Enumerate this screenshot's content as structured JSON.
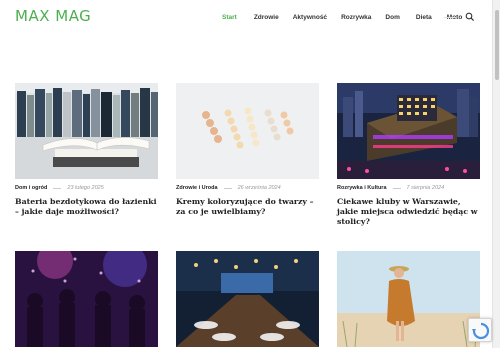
{
  "header": {
    "logo": "MAX MAG",
    "nav": [
      "Start",
      "Zdrowie",
      "Aktywność",
      "Rozrywka",
      "Dom",
      "Dieta",
      "Moto"
    ],
    "active": "Start",
    "icons": {
      "search": "search-icon"
    }
  },
  "posts": [
    {
      "category": "Dom i ogród",
      "date": "23 lutego 2025",
      "title": "Bateria bezdotykowa do łazienki – jakie daje możliwości?",
      "image": "books-illustration"
    },
    {
      "category": "Zdrowie i Uroda",
      "date": "26 września 2024",
      "title": "Kremy koloryzujące do twarzy – za co je uwielbiamy?",
      "image": "cream-swatches-illustration"
    },
    {
      "category": "Rozrywka i Kultura",
      "date": "7 sierpnia 2024",
      "title": "Ciekawe kluby w Warszawie, jakie miejsca odwiedzić będąc w stolicy?",
      "image": "night-city-illustration"
    },
    {
      "category": "",
      "date": "",
      "title": "",
      "image": "party-crowd-illustration"
    },
    {
      "category": "",
      "date": "",
      "title": "",
      "image": "banquet-hall-illustration"
    },
    {
      "category": "",
      "date": "",
      "title": "",
      "image": "woman-beach-illustration"
    }
  ],
  "colors": {
    "accent": "#4caf50",
    "text": "#222222",
    "date": "#999999"
  }
}
